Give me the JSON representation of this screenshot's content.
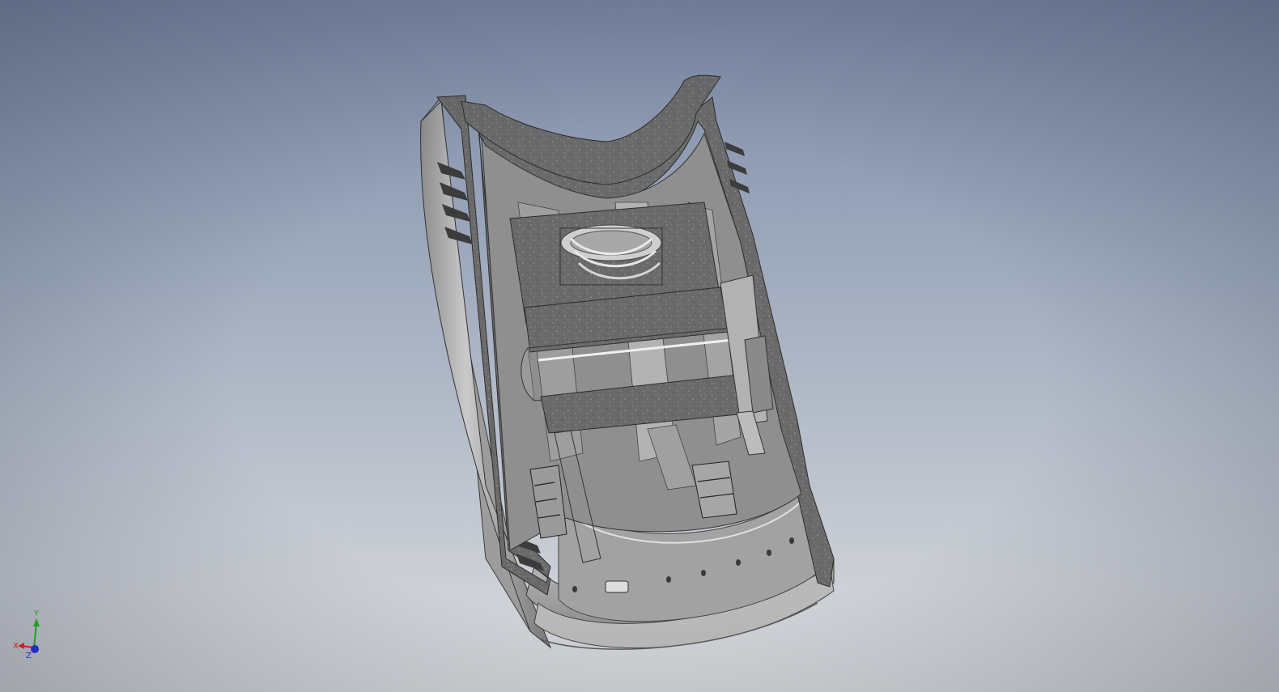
{
  "viewport": {
    "background_top": "#7d8aa6",
    "background_bottom": "#d3d4d7"
  },
  "model": {
    "cut_face_color": "#6b6b6b",
    "body_color": "#a8a8a8",
    "highlight_color": "#d8d8d8"
  },
  "view_triad": {
    "x_label": "X",
    "y_label": "Y",
    "z_label": "Z",
    "x_color": "#d02020",
    "y_color": "#1fa01f",
    "z_color": "#2030c0"
  }
}
